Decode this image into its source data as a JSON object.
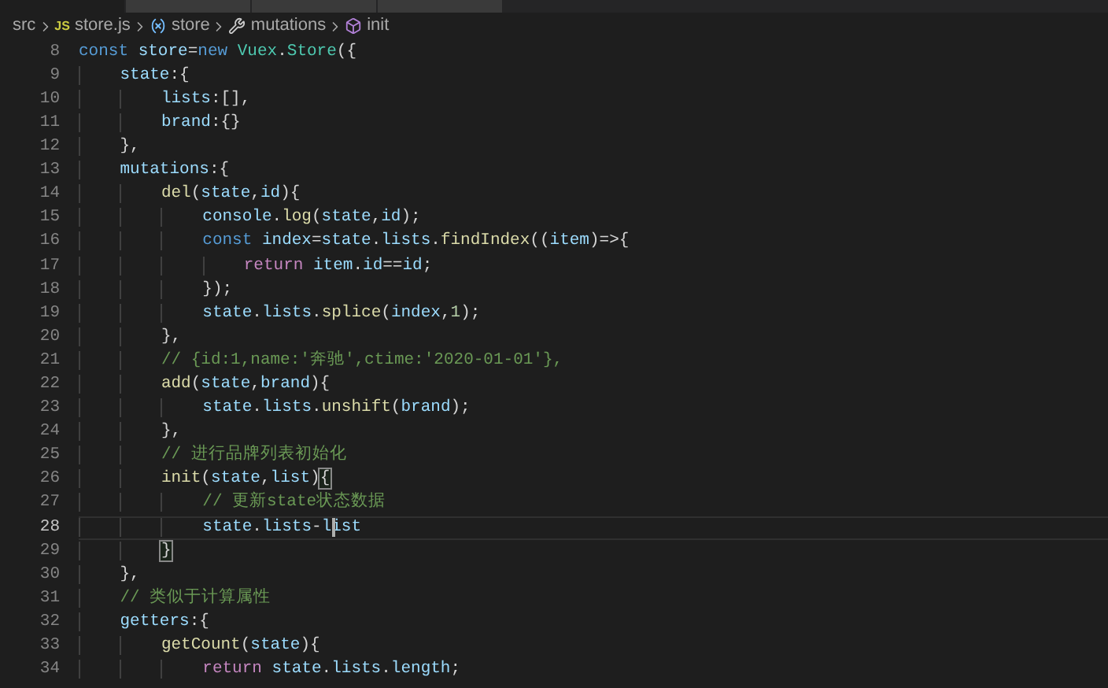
{
  "tabs": [
    {
      "selected": true
    },
    {
      "selected": false
    },
    {
      "selected": false
    },
    {
      "selected": false
    }
  ],
  "breadcrumb": [
    {
      "text": "src",
      "kind": "folder"
    },
    {
      "text": "store.js",
      "kind": "js",
      "icon_text": "JS"
    },
    {
      "text": "store",
      "kind": "variable"
    },
    {
      "text": "mutations",
      "kind": "property"
    },
    {
      "text": "init",
      "kind": "method"
    }
  ],
  "code_lines": [
    {
      "number": "8",
      "current": false,
      "tokens": [
        {
          "text": "const ",
          "kind": "keyword"
        },
        {
          "text": "store",
          "kind": "var"
        },
        {
          "text": "=",
          "kind": "punct"
        },
        {
          "text": "new ",
          "kind": "keyword"
        },
        {
          "text": "Vuex",
          "kind": "class"
        },
        {
          "text": ".",
          "kind": "punct"
        },
        {
          "text": "Store",
          "kind": "class"
        },
        {
          "text": "({",
          "kind": "punct"
        }
      ]
    },
    {
      "number": "9",
      "current": false,
      "tokens": [
        {
          "text": "    state",
          "kind": "var"
        },
        {
          "text": ":{",
          "kind": "punct"
        }
      ]
    },
    {
      "number": "10",
      "current": false,
      "tokens": [
        {
          "text": "        lists",
          "kind": "var"
        },
        {
          "text": ":[],",
          "kind": "punct"
        }
      ]
    },
    {
      "number": "11",
      "current": false,
      "tokens": [
        {
          "text": "        brand",
          "kind": "var"
        },
        {
          "text": ":{}",
          "kind": "punct"
        }
      ]
    },
    {
      "number": "12",
      "current": false,
      "tokens": [
        {
          "text": "    },",
          "kind": "punct"
        }
      ]
    },
    {
      "number": "13",
      "current": false,
      "tokens": [
        {
          "text": "    mutations",
          "kind": "var"
        },
        {
          "text": ":{",
          "kind": "punct"
        }
      ]
    },
    {
      "number": "14",
      "current": false,
      "tokens": [
        {
          "text": "        del",
          "kind": "fn"
        },
        {
          "text": "(",
          "kind": "punct"
        },
        {
          "text": "state",
          "kind": "var"
        },
        {
          "text": ",",
          "kind": "punct"
        },
        {
          "text": "id",
          "kind": "var"
        },
        {
          "text": "){",
          "kind": "punct"
        }
      ]
    },
    {
      "number": "15",
      "current": false,
      "tokens": [
        {
          "text": "            console",
          "kind": "var"
        },
        {
          "text": ".",
          "kind": "punct"
        },
        {
          "text": "log",
          "kind": "fn"
        },
        {
          "text": "(",
          "kind": "punct"
        },
        {
          "text": "state",
          "kind": "var"
        },
        {
          "text": ",",
          "kind": "punct"
        },
        {
          "text": "id",
          "kind": "var"
        },
        {
          "text": ");",
          "kind": "punct"
        }
      ]
    },
    {
      "number": "16",
      "current": false,
      "tokens": [
        {
          "text": "            const ",
          "kind": "keyword"
        },
        {
          "text": "index",
          "kind": "var"
        },
        {
          "text": "=",
          "kind": "punct"
        },
        {
          "text": "state",
          "kind": "var"
        },
        {
          "text": ".",
          "kind": "punct"
        },
        {
          "text": "lists",
          "kind": "var"
        },
        {
          "text": ".",
          "kind": "punct"
        },
        {
          "text": "findIndex",
          "kind": "fn"
        },
        {
          "text": "((",
          "kind": "punct"
        },
        {
          "text": "item",
          "kind": "var"
        },
        {
          "text": ")=>{",
          "kind": "punct"
        }
      ]
    },
    {
      "number": "17",
      "current": false,
      "tokens": [
        {
          "text": "                return ",
          "kind": "control"
        },
        {
          "text": "item",
          "kind": "var"
        },
        {
          "text": ".",
          "kind": "punct"
        },
        {
          "text": "id",
          "kind": "var"
        },
        {
          "text": "==",
          "kind": "punct"
        },
        {
          "text": "id",
          "kind": "var"
        },
        {
          "text": ";",
          "kind": "punct"
        }
      ]
    },
    {
      "number": "18",
      "current": false,
      "tokens": [
        {
          "text": "            });",
          "kind": "punct"
        }
      ]
    },
    {
      "number": "19",
      "current": false,
      "tokens": [
        {
          "text": "            state",
          "kind": "var"
        },
        {
          "text": ".",
          "kind": "punct"
        },
        {
          "text": "lists",
          "kind": "var"
        },
        {
          "text": ".",
          "kind": "punct"
        },
        {
          "text": "splice",
          "kind": "fn"
        },
        {
          "text": "(",
          "kind": "punct"
        },
        {
          "text": "index",
          "kind": "var"
        },
        {
          "text": ",",
          "kind": "punct"
        },
        {
          "text": "1",
          "kind": "number"
        },
        {
          "text": ");",
          "kind": "punct"
        }
      ]
    },
    {
      "number": "20",
      "current": false,
      "tokens": [
        {
          "text": "        },",
          "kind": "punct"
        }
      ]
    },
    {
      "number": "21",
      "current": false,
      "tokens": [
        {
          "text": "        // {id:1,name:'奔驰',ctime:'2020-01-01'},",
          "kind": "comment"
        }
      ]
    },
    {
      "number": "22",
      "current": false,
      "tokens": [
        {
          "text": "        add",
          "kind": "fn"
        },
        {
          "text": "(",
          "kind": "punct"
        },
        {
          "text": "state",
          "kind": "var"
        },
        {
          "text": ",",
          "kind": "punct"
        },
        {
          "text": "brand",
          "kind": "var"
        },
        {
          "text": "){",
          "kind": "punct"
        }
      ]
    },
    {
      "number": "23",
      "current": false,
      "tokens": [
        {
          "text": "            state",
          "kind": "var"
        },
        {
          "text": ".",
          "kind": "punct"
        },
        {
          "text": "lists",
          "kind": "var"
        },
        {
          "text": ".",
          "kind": "punct"
        },
        {
          "text": "unshift",
          "kind": "fn"
        },
        {
          "text": "(",
          "kind": "punct"
        },
        {
          "text": "brand",
          "kind": "var"
        },
        {
          "text": ");",
          "kind": "punct"
        }
      ]
    },
    {
      "number": "24",
      "current": false,
      "tokens": [
        {
          "text": "        },",
          "kind": "punct"
        }
      ]
    },
    {
      "number": "25",
      "current": false,
      "tokens": [
        {
          "text": "        // 进行品牌列表初始化",
          "kind": "comment"
        }
      ]
    },
    {
      "number": "26",
      "current": false,
      "tokens": [
        {
          "text": "        init",
          "kind": "fn"
        },
        {
          "text": "(",
          "kind": "punct"
        },
        {
          "text": "state",
          "kind": "var"
        },
        {
          "text": ",",
          "kind": "punct"
        },
        {
          "text": "list",
          "kind": "var"
        },
        {
          "text": ")",
          "kind": "punct"
        },
        {
          "text": "{",
          "kind": "punct",
          "matched": true
        }
      ]
    },
    {
      "number": "27",
      "current": false,
      "tokens": [
        {
          "text": "            // 更新state状态数据",
          "kind": "comment"
        }
      ]
    },
    {
      "number": "28",
      "current": true,
      "tokens": [
        {
          "text": "            state",
          "kind": "var"
        },
        {
          "text": ".",
          "kind": "punct"
        },
        {
          "text": "lists",
          "kind": "var"
        },
        {
          "text": "-",
          "kind": "punct"
        },
        {
          "text": "l",
          "kind": "var"
        },
        {
          "text": "ist",
          "kind": "var",
          "caret": true
        }
      ]
    },
    {
      "number": "29",
      "current": false,
      "tokens": [
        {
          "text": "        }",
          "kind": "punct",
          "matched": true
        }
      ]
    },
    {
      "number": "30",
      "current": false,
      "tokens": [
        {
          "text": "    },",
          "kind": "punct"
        }
      ]
    },
    {
      "number": "31",
      "current": false,
      "tokens": [
        {
          "text": "    // 类似于计算属性",
          "kind": "comment"
        }
      ]
    },
    {
      "number": "32",
      "current": false,
      "tokens": [
        {
          "text": "    getters",
          "kind": "var"
        },
        {
          "text": ":{",
          "kind": "punct"
        }
      ]
    },
    {
      "number": "33",
      "current": false,
      "tokens": [
        {
          "text": "        getCount",
          "kind": "fn"
        },
        {
          "text": "(",
          "kind": "punct"
        },
        {
          "text": "state",
          "kind": "var"
        },
        {
          "text": "){",
          "kind": "punct"
        }
      ]
    },
    {
      "number": "34",
      "current": false,
      "tokens": [
        {
          "text": "            return ",
          "kind": "control"
        },
        {
          "text": "state",
          "kind": "var"
        },
        {
          "text": ".",
          "kind": "punct"
        },
        {
          "text": "lists",
          "kind": "var"
        },
        {
          "text": ".",
          "kind": "punct"
        },
        {
          "text": "length",
          "kind": "var"
        },
        {
          "text": ";",
          "kind": "punct"
        }
      ]
    }
  ]
}
